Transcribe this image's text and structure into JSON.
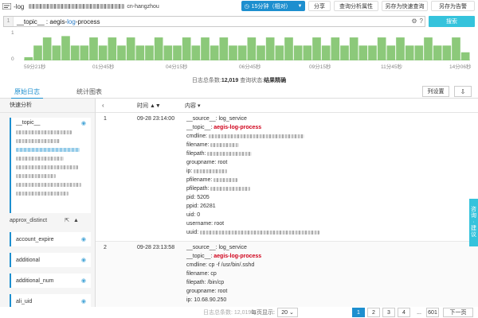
{
  "header": {
    "title": "-log",
    "region": "cn-hangzhou",
    "time_button": "15分钟（相对）",
    "share": "分享",
    "query_attr": "查询分析属性",
    "save_quick": "另存为快速查询",
    "save_alarm": "另存为告警"
  },
  "query": {
    "line_no": "1",
    "prefix": "__topic__ : aegis-",
    "keyword": "log",
    "suffix": "-process",
    "search_button": "搜索"
  },
  "histogram": {
    "ytop": "1",
    "ybottom": "0",
    "x_labels": [
      "59分21秒",
      "01分45秒",
      "04分15秒",
      "06分45秒",
      "09分15秒",
      "11分45秒",
      "14分06秒"
    ]
  },
  "chart_data": {
    "type": "bar",
    "ylim": [
      0,
      1
    ],
    "values": [
      0.12,
      0.55,
      0.85,
      0.55,
      0.9,
      0.55,
      0.55,
      0.85,
      0.55,
      0.85,
      0.55,
      0.85,
      0.55,
      0.55,
      0.85,
      0.55,
      0.55,
      0.85,
      0.55,
      0.85,
      0.55,
      0.85,
      0.55,
      0.55,
      0.85,
      0.55,
      0.85,
      0.55,
      0.85,
      0.55,
      0.55,
      0.85,
      0.55,
      0.85,
      0.55,
      0.85,
      0.55,
      0.55,
      0.85,
      0.55,
      0.85,
      0.55,
      0.55,
      0.85,
      0.55,
      0.55,
      0.85,
      0.3
    ]
  },
  "summary": {
    "total_label": "日志总条数:",
    "total": "12,019",
    "status_label": "查询状态:",
    "status": "结果精确"
  },
  "tabs": {
    "raw": "原始日志",
    "stats": "统计图表",
    "columns_button": "列设置"
  },
  "sidebar": {
    "heading": "快速分析",
    "topic_field": "__topic__",
    "approx": "approx_distinct",
    "fields": [
      "account_expire",
      "additional",
      "additional_num",
      "ali_uid"
    ]
  },
  "table": {
    "time_header": "时间",
    "content_header": "内容",
    "rows": [
      {
        "index": "1",
        "time": "09-28 23:14:00",
        "source": "log_service",
        "topic": "aegis-log-process",
        "groupname": "root",
        "pid": "5205",
        "ppid": "26281",
        "uid": "0",
        "username": "root"
      },
      {
        "index": "2",
        "time": "09-28 23:13:58",
        "source": "log_service",
        "topic": "aegis-log-process",
        "cmdline": "cp -f /usr/bin/.sshd",
        "filename": "cp",
        "filepath": "/bin/cp",
        "groupname": "root",
        "ip": "10.68.90.250"
      }
    ],
    "keys": {
      "source": "__source__:",
      "topic": "__topic__:",
      "cmdline": "cmdline:",
      "filename": "filename:",
      "filepath": "filepath:",
      "groupname": "groupname:",
      "ip": "ip:",
      "pfilename": "pfilename:",
      "pfilepath": "pfilepath:",
      "pid": "pid:",
      "ppid": "ppid:",
      "uid": "uid:",
      "username": "username:",
      "uuid": "uuid:"
    }
  },
  "footer": {
    "total": "日志总条数: 12,019",
    "per_page": "每页显示:",
    "page_size": "20",
    "pages": [
      "1",
      "2",
      "3",
      "4",
      "...",
      "601"
    ],
    "next": "下一页"
  },
  "feedback": [
    "咨",
    "询",
    "·",
    "建",
    "议"
  ],
  "colors": {
    "accent": "#1d8fcf",
    "search": "#35c3dc",
    "bar": "#8cc97a",
    "highlight": "#d0021b"
  }
}
